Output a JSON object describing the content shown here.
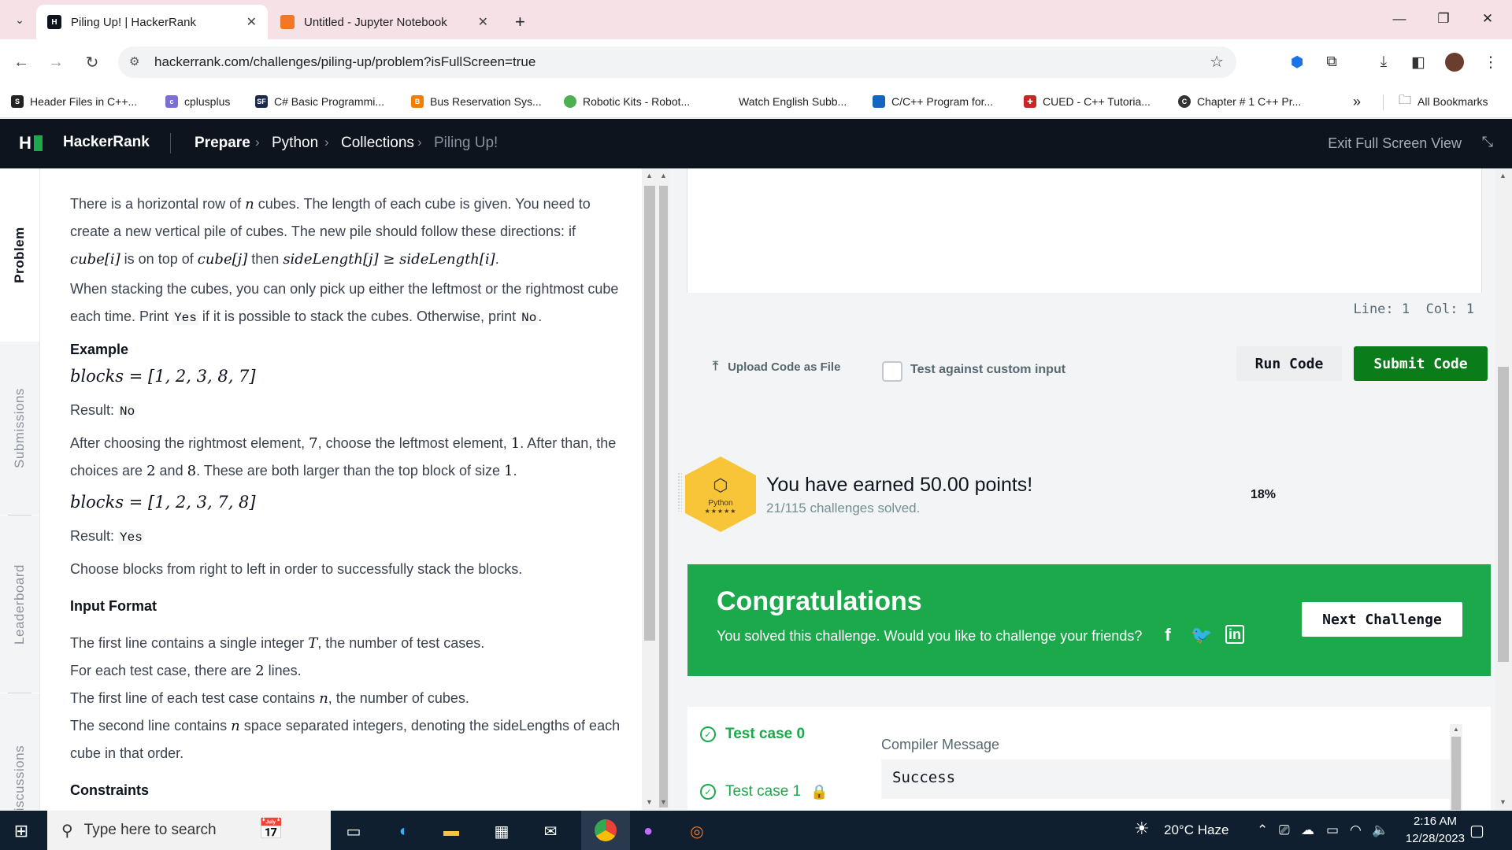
{
  "browser": {
    "tabs": [
      {
        "title": "Piling Up! | HackerRank",
        "active": true
      },
      {
        "title": "Untitled - Jupyter Notebook",
        "active": false
      }
    ],
    "url": "hackerrank.com/challenges/piling-up/problem?isFullScreen=true",
    "bookmarks": [
      "Header Files in C++...",
      "cplusplus",
      "C# Basic Programmi...",
      "Bus Reservation Sys...",
      "Robotic Kits - Robot...",
      "Watch English Subb...",
      "C/C++ Program for...",
      "CUED - C++ Tutoria...",
      "Chapter # 1 C++ Pr..."
    ],
    "all_bookmarks": "All Bookmarks",
    "more_glyph": "»"
  },
  "hr_header": {
    "brand": "HackerRank",
    "breadcrumbs": [
      "Prepare",
      "Python",
      "Collections",
      "Piling Up!"
    ],
    "exit_fullscreen": "Exit Full Screen View"
  },
  "side_tabs": [
    "Problem",
    "Submissions",
    "Leaderboard",
    "Discussions"
  ],
  "problem": {
    "p1a": "There is a horizontal row of",
    "p1b": "cubes. The length of each cube is given. You need to create a new vertical pile of cubes. The new pile should follow these directions: if",
    "p1c": "is on top of",
    "p1d": "then",
    "p2a": "When stacking the cubes, you can only pick up either the leftmost or the rightmost cube each time. Print",
    "p2b": "if it is possible to stack the cubes. Otherwise, print",
    "yes": "Yes",
    "no": "No",
    "example_heading": "Example",
    "blocks1": "blocks = [1, 2, 3, 8, 7]",
    "result_label": "Result:",
    "p3a": "After choosing the rightmost element,",
    "p3b": ", choose the leftmost element,",
    "p3c": ". After than, the choices are",
    "p3d": "and",
    "p3e": ". These are both larger than the top block of size",
    "blocks2": "blocks = [1, 2, 3, 7, 8]",
    "p4": "Choose blocks from right to left in order to successfully stack the blocks.",
    "input_heading": "Input Format",
    "if1a": "The first line contains a single integer",
    "if1b": ", the number of test cases.",
    "if2a": "For each test case, there are",
    "if2b": "lines.",
    "if3a": "The first line of each test case contains",
    "if3b": ", the number of cubes.",
    "if4a": "The second line contains",
    "if4b": "space separated integers, denoting the sideLengths of each cube in that order.",
    "constraints_heading": "Constraints",
    "math": {
      "n": "n",
      "cube_i": "cube[i]",
      "cube_j": "cube[j]",
      "ineq": "sideLength[j] ≥ sideLength[i]",
      "seven": "7",
      "one": "1",
      "two": "2",
      "eight": "8",
      "T": "T"
    }
  },
  "editor": {
    "status": "Line: 1  Col: 1",
    "upload": "Upload Code as File",
    "custom_input": "Test against custom input",
    "run": "Run Code",
    "submit": "Submit Code"
  },
  "earned": {
    "title": "You have earned 50.00 points!",
    "subtitle": "21/115 challenges solved.",
    "badge_label": "Python",
    "badge_stars": "★★★★★",
    "progress": "18%"
  },
  "congrats": {
    "title": "Congratulations",
    "subtitle": "You solved this challenge. Would you like to challenge your friends?",
    "next": "Next Challenge"
  },
  "tests": {
    "cases": [
      "Test case 0",
      "Test case 1"
    ],
    "compiler_label": "Compiler Message",
    "compiler_value": "Success"
  },
  "taskbar": {
    "search_placeholder": "Type here to search",
    "weather": "20°C  Haze",
    "time": "2:16 AM",
    "date": "12/28/2023"
  },
  "colors": {
    "hr_dark": "#0e141e",
    "hr_green": "#1ba94c",
    "submit_green": "#0a7c1a",
    "badge_gold": "#f7c537"
  }
}
